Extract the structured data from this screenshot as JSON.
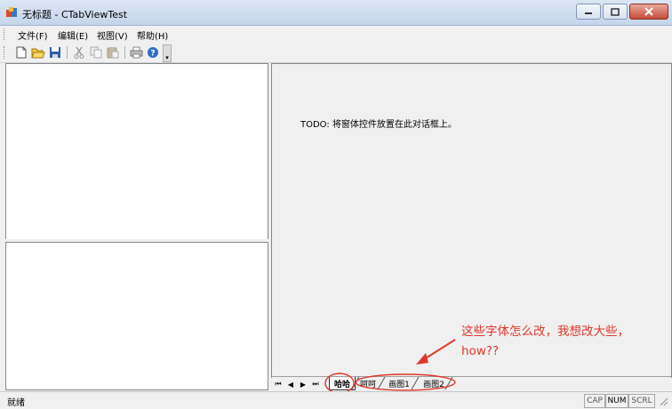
{
  "window": {
    "title": "无标题 - CTabViewTest",
    "app_icon": "app-icon",
    "controls": [
      "minimize-icon",
      "maximize-icon",
      "close-icon"
    ]
  },
  "menubar": {
    "items": [
      "文件(F)",
      "编辑(E)",
      "视图(V)",
      "帮助(H)"
    ]
  },
  "toolbar": {
    "buttons": [
      "new-icon",
      "open-icon",
      "save-icon",
      "cut-icon",
      "copy-icon",
      "paste-icon",
      "print-icon",
      "help-icon"
    ]
  },
  "main": {
    "placeholder_text": "TODO: 将窗体控件放置在此对话框上。"
  },
  "tabbar": {
    "nav": [
      "⏮",
      "◀",
      "▶",
      "⏭"
    ],
    "tabs": [
      "哈哈",
      "呵呵",
      "画图1",
      "画图2"
    ],
    "active_tab": "哈哈"
  },
  "statusbar": {
    "text": "就绪",
    "indicators": [
      "CAP",
      "NUM",
      "SCRL"
    ],
    "active_indicator": "NUM"
  },
  "annotation": {
    "line1": "这些字体怎么改，我想改大些，",
    "line2": "how??",
    "color": "#e0382b"
  }
}
